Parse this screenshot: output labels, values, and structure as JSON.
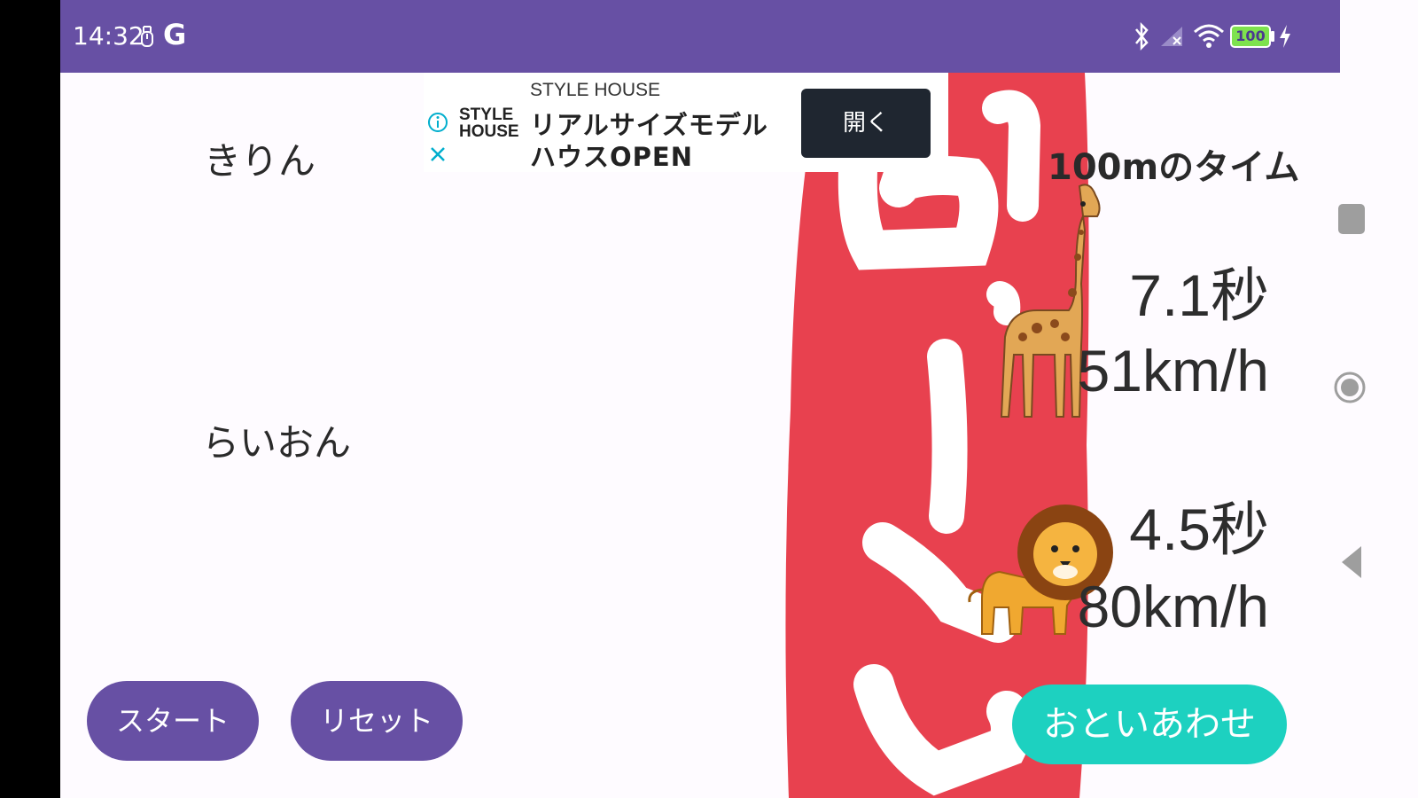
{
  "status_bar": {
    "time": "14:32",
    "g_label": "G",
    "battery_level": "100"
  },
  "ad": {
    "logo_line1": "STYLE",
    "logo_line2": "HOUSE",
    "brand": "STYLE HOUSE",
    "headline_line1": "リアルサイズモデル",
    "headline_line2": "ハウスOPEN",
    "open_label": "開く"
  },
  "main": {
    "animals": [
      {
        "name": "きりん",
        "time": "7.1秒",
        "speed": "51km/h"
      },
      {
        "name": "らいおん",
        "time": "4.5秒",
        "speed": "80km/h"
      }
    ],
    "header": "100mのタイム"
  },
  "buttons": {
    "start_label": "スタート",
    "reset_label": "リセット",
    "contact_label": "おといあわせ"
  },
  "colors": {
    "primary": "#6750a4",
    "accent": "#1dd1c0",
    "tape_red": "#e8414f"
  },
  "icons": [
    "usb-icon",
    "bluetooth-icon",
    "signal-icon",
    "wifi-icon",
    "battery-icon",
    "charging-icon",
    "info-icon",
    "close-icon",
    "recents-icon",
    "home-icon",
    "back-icon"
  ]
}
